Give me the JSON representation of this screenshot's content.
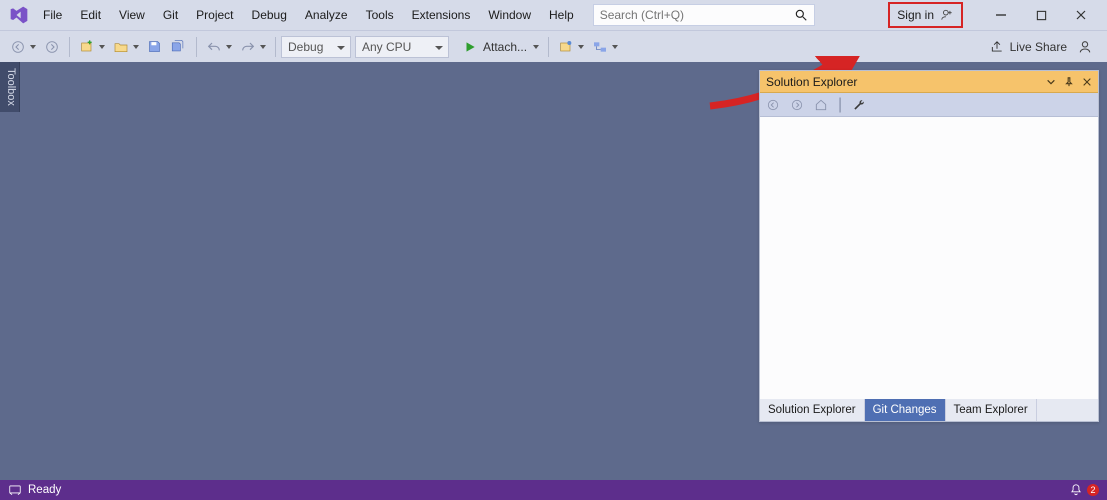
{
  "menu": {
    "items": [
      "File",
      "Edit",
      "View",
      "Git",
      "Project",
      "Debug",
      "Analyze",
      "Tools",
      "Extensions",
      "Window",
      "Help"
    ],
    "search_placeholder": "Search (Ctrl+Q)",
    "signin": "Sign in",
    "liveshare": "Live Share"
  },
  "toolbar": {
    "config": "Debug",
    "platform": "Any CPU",
    "attach": "Attach..."
  },
  "sidebar": {
    "toolbox": "Toolbox"
  },
  "panel": {
    "title": "Solution Explorer",
    "tabs": [
      "Solution Explorer",
      "Git Changes",
      "Team Explorer"
    ],
    "active_tab_index": 1
  },
  "status": {
    "left": "Ready",
    "notification_count": "2"
  }
}
